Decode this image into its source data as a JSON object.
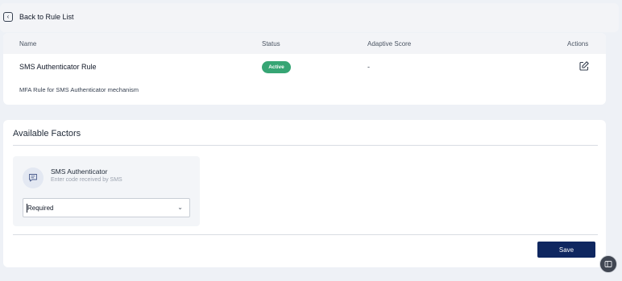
{
  "back": {
    "label": "Back to Rule List",
    "icon": "chevron-left-icon"
  },
  "rule_table": {
    "columns": [
      "Name",
      "Status",
      "Adaptive Score",
      "Actions"
    ],
    "row": {
      "name": "SMS Authenticator Rule",
      "status": "Active",
      "adaptive_score": "-",
      "action_icon": "edit-icon",
      "description": "MFA Rule for SMS Authenticator mechanism"
    },
    "status_color": "#36a574"
  },
  "factors": {
    "title": "Available Factors",
    "items": [
      {
        "name": "SMS Authenticator",
        "subtitle": "Enter code received by SMS",
        "icon": "message-icon",
        "requirement": "Required"
      }
    ]
  },
  "save_label": "Save",
  "accent_color": "#0f2760"
}
